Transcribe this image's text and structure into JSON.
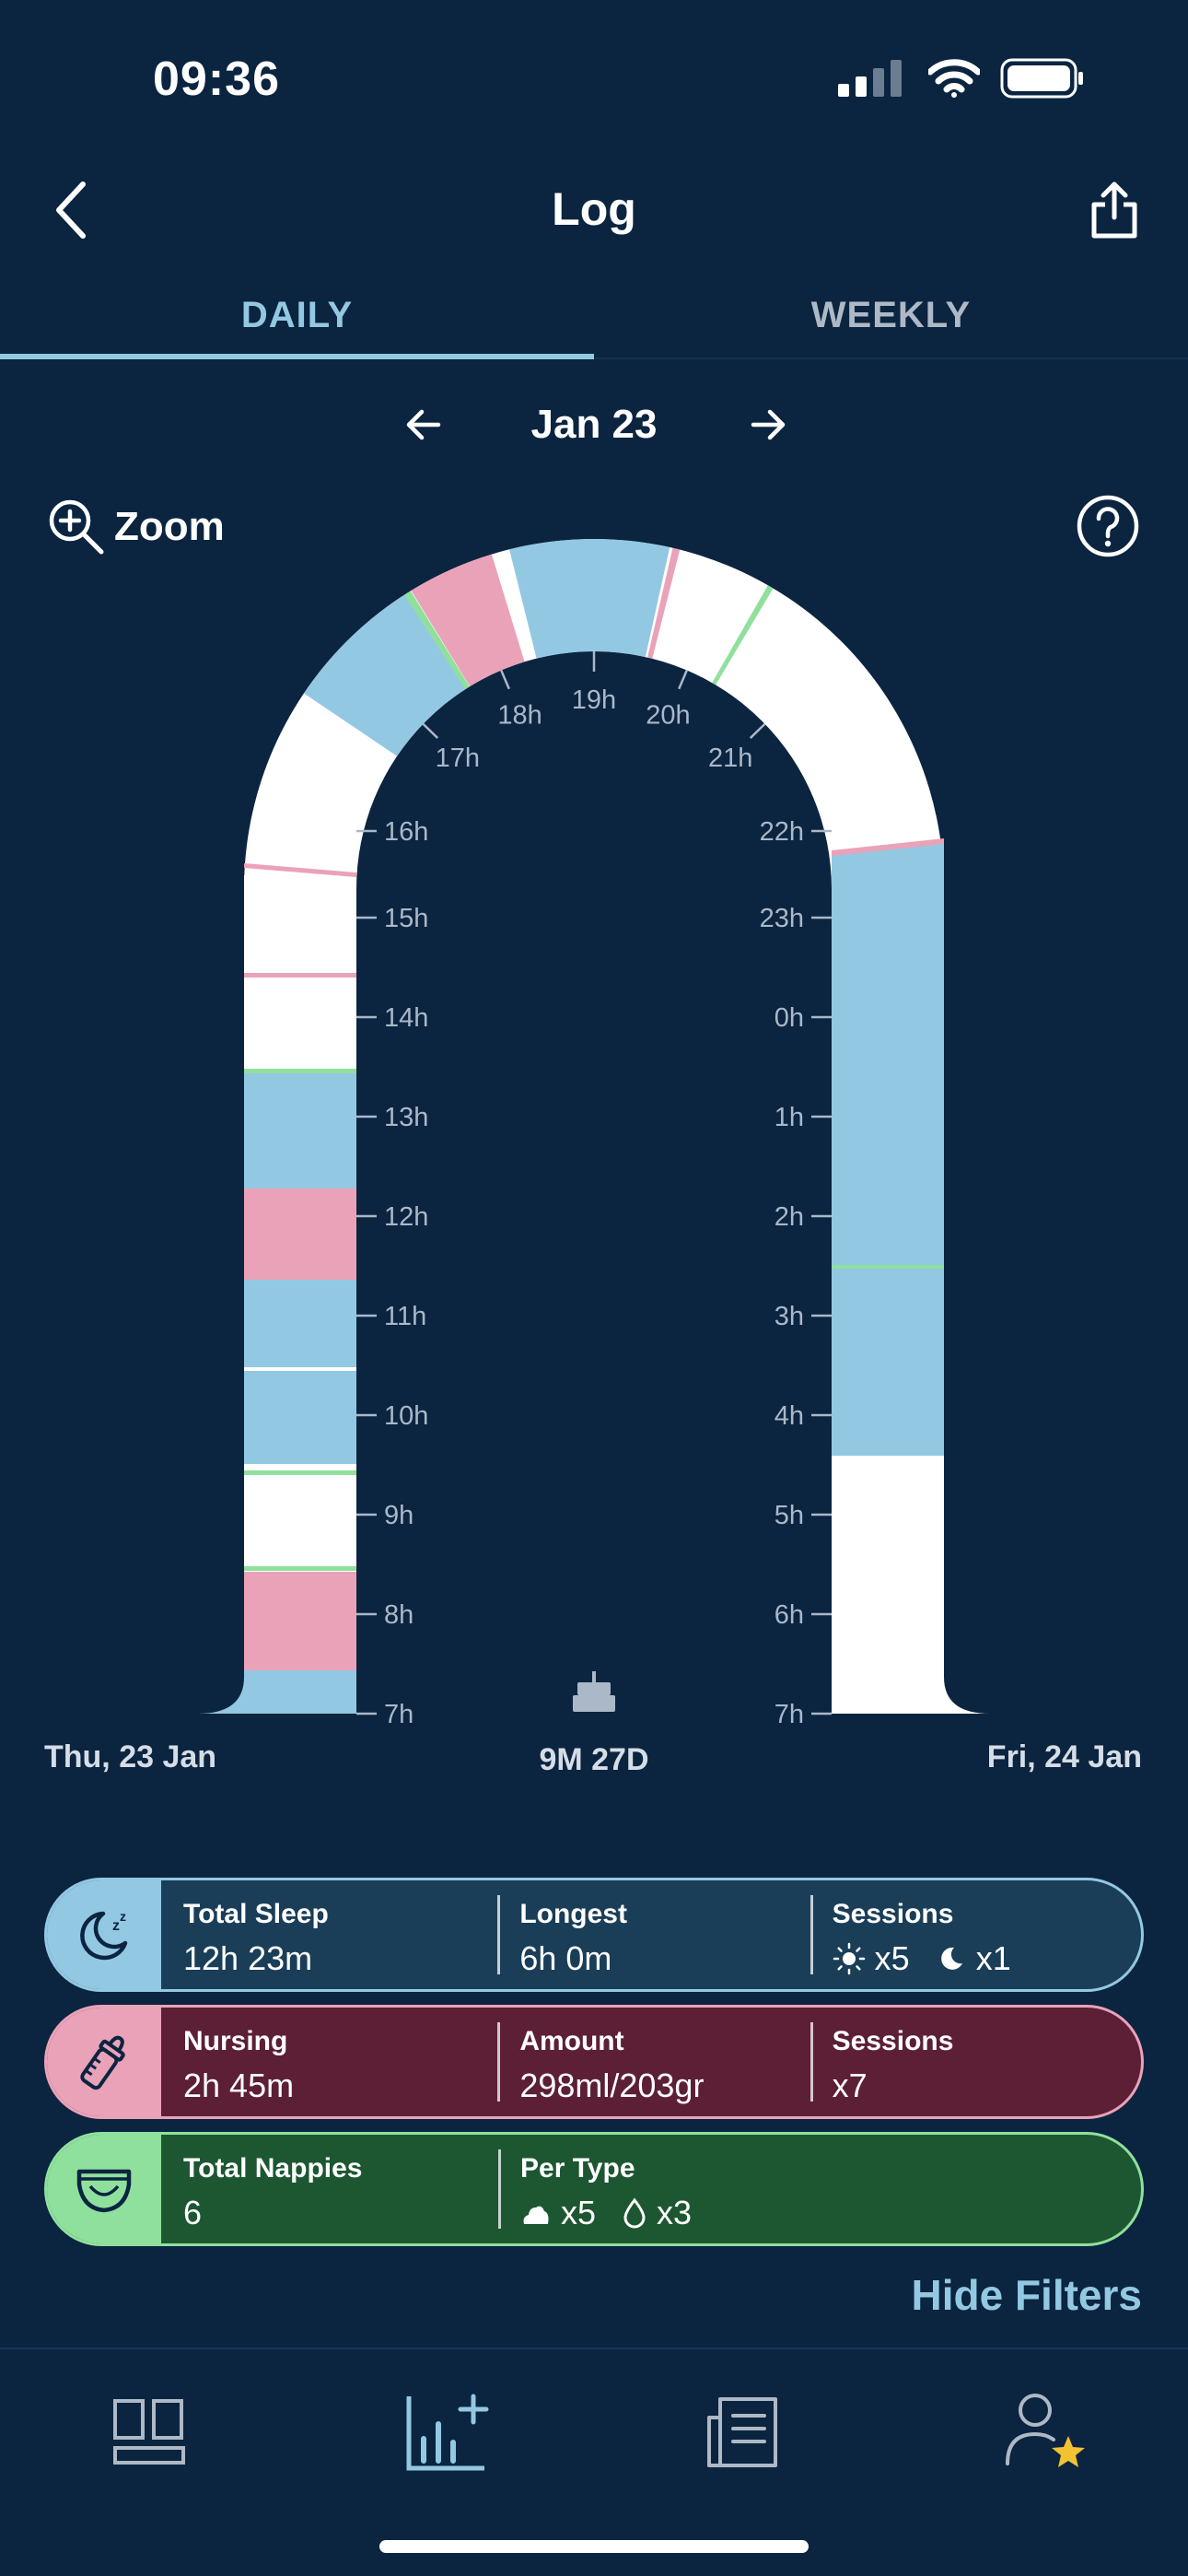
{
  "status_bar": {
    "time": "09:36"
  },
  "header": {
    "title": "Log"
  },
  "tabs": [
    {
      "label": "DAILY",
      "active": true
    },
    {
      "label": "WEEKLY",
      "active": false
    }
  ],
  "date_nav": {
    "label": "Jan 23"
  },
  "zoom": {
    "label": "Zoom"
  },
  "chart": {
    "left_hours": [
      "7h",
      "8h",
      "9h",
      "10h",
      "11h",
      "12h",
      "13h",
      "14h",
      "15h",
      "16h",
      "17h",
      "18h"
    ],
    "top_hours": [
      "19h"
    ],
    "right_hours": [
      "20h",
      "21h",
      "22h",
      "23h",
      "0h",
      "1h",
      "2h",
      "3h",
      "4h",
      "5h",
      "6h",
      "7h"
    ],
    "start_day": "Thu, 23 Jan",
    "end_day": "Fri, 24 Jan",
    "age": "9M 27D",
    "colors": {
      "sleep": "#93c8e3",
      "feed": "#eaa2b8",
      "nappy": "#90e09d",
      "empty": "#ffffff",
      "background": "#0b2440"
    }
  },
  "summary": {
    "sleep": {
      "total_label": "Total Sleep",
      "total_value": "12h 23m",
      "longest_label": "Longest",
      "longest_value": "6h 0m",
      "sessions_label": "Sessions",
      "day_count": "x5",
      "night_count": "x1"
    },
    "nursing": {
      "total_label": "Nursing",
      "total_value": "2h 45m",
      "amount_label": "Amount",
      "amount_value": "298ml/203gr",
      "sessions_label": "Sessions",
      "sessions_value": "x7"
    },
    "nappies": {
      "total_label": "Total Nappies",
      "total_value": "6",
      "type_label": "Per Type",
      "solid_count": "x5",
      "wet_count": "x3"
    }
  },
  "hide_filters": {
    "label": "Hide Filters"
  }
}
